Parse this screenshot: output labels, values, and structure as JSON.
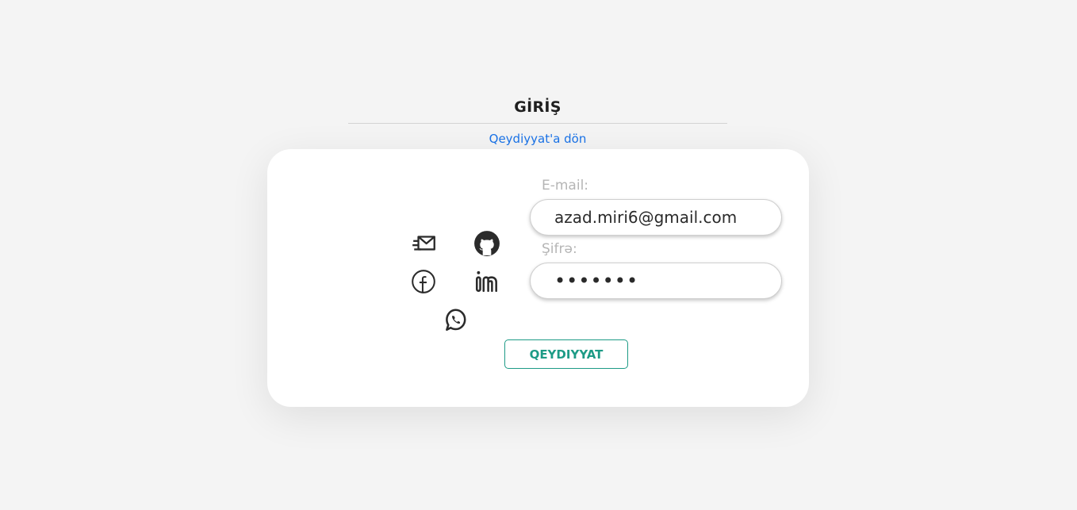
{
  "header": {
    "title": "GİRİŞ",
    "back_link": "Qeydiyyat'a dön"
  },
  "social": {
    "icons": [
      "email-icon",
      "github-icon",
      "facebook-icon",
      "linkedin-icon",
      "whatsapp-icon"
    ]
  },
  "form": {
    "email_label": "E-mail:",
    "email_value": "azad.miri6@gmail.com",
    "password_label": "Şifrə:",
    "password_value": "•••••••",
    "submit_label": "QEYDIYYAT"
  },
  "colors": {
    "background": "#f4f4f4",
    "card": "#ffffff",
    "link": "#1a73e8",
    "accent": "#1d9b86",
    "label": "#b5b5b5"
  }
}
